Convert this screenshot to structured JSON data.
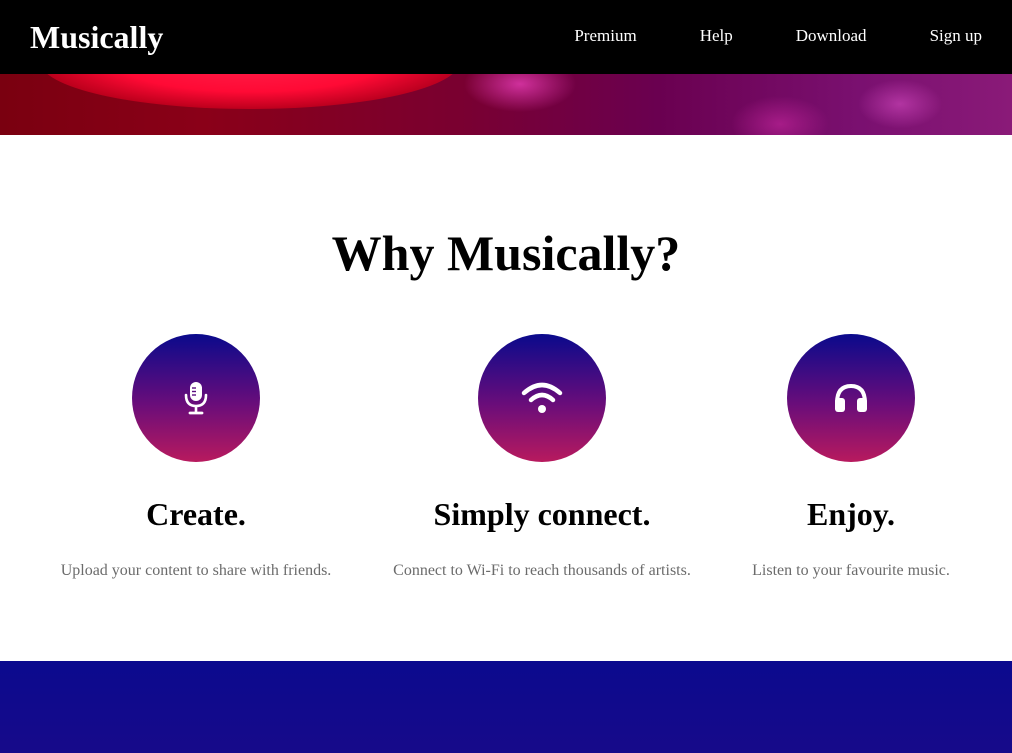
{
  "navbar": {
    "brand": "Musically",
    "links": [
      {
        "label": "Premium"
      },
      {
        "label": "Help"
      },
      {
        "label": "Download"
      },
      {
        "label": "Sign up"
      }
    ]
  },
  "features": {
    "title": "Why Musically?",
    "items": [
      {
        "icon": "microphone-icon",
        "title": "Create.",
        "description": "Upload your content to share with friends."
      },
      {
        "icon": "wifi-icon",
        "title": "Simply connect.",
        "description": "Connect to Wi-Fi to reach thousands of artists."
      },
      {
        "icon": "headphones-icon",
        "title": "Enjoy.",
        "description": "Listen to your favourite music."
      }
    ]
  },
  "colors": {
    "navbar_bg": "#000000",
    "circle_gradient_top": "#0a0a8c",
    "circle_gradient_bottom": "#b81a5e",
    "bottom_band": "#0b0a8e",
    "description_text": "#6b6b6b"
  }
}
